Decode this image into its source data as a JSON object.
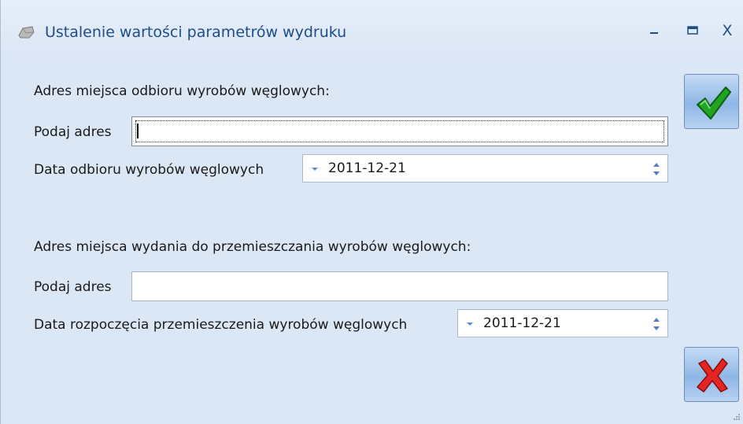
{
  "window": {
    "title": "Ustalenie wartości parametrów wydruku",
    "controls": {
      "minimize_icon": "minimize-icon",
      "maximize_icon": "maximize-icon",
      "close_label": "X"
    }
  },
  "section_pickup": {
    "heading": "Adres miejsca odbioru wyrobów węglowych:",
    "address_label": "Podaj adres",
    "address_value": "",
    "date_label": "Data odbioru wyrobów węglowych",
    "date_value": "2011-12-21"
  },
  "section_dispatch": {
    "heading": "Adres miejsca wydania do przemieszczania wyrobów węglowych:",
    "address_label": "Podaj adres",
    "address_value": "",
    "date_label": "Data rozpoczęcia przemieszczenia wyrobów węglowych",
    "date_value": "2011-12-21"
  },
  "actions": {
    "confirm_icon": "checkmark-icon",
    "cancel_icon": "red-x-icon"
  },
  "colors": {
    "background": "#dce7f5",
    "title_text": "#1d4d8a",
    "confirm_green": "#1f9a1f",
    "cancel_red": "#e02020"
  }
}
